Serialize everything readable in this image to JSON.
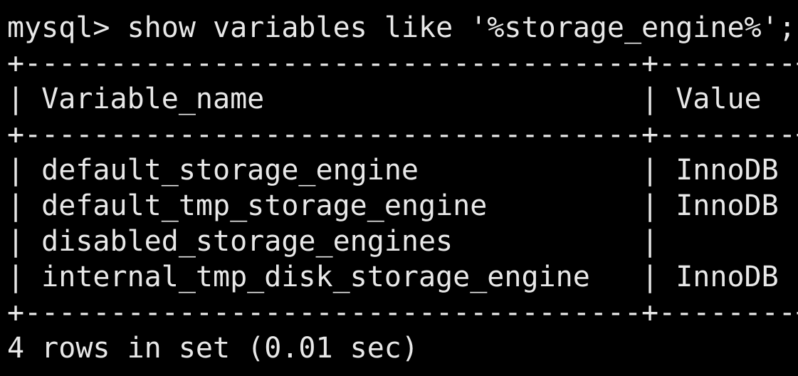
{
  "terminal": {
    "prompt": "mysql>",
    "command": "show variables like '%storage_engine%';",
    "table_border": "+------------------------------------+--------+",
    "columns": [
      "Variable_name",
      "Value"
    ],
    "rows": [
      [
        "default_storage_engine",
        "InnoDB"
      ],
      [
        "default_tmp_storage_engine",
        "InnoDB"
      ],
      [
        "disabled_storage_engines",
        ""
      ],
      [
        "internal_tmp_disk_storage_engine",
        "InnoDB"
      ]
    ],
    "footer": "4 rows in set (0.01 sec)"
  },
  "colors": {
    "background": "#000000",
    "text": "#e8e8e8"
  }
}
